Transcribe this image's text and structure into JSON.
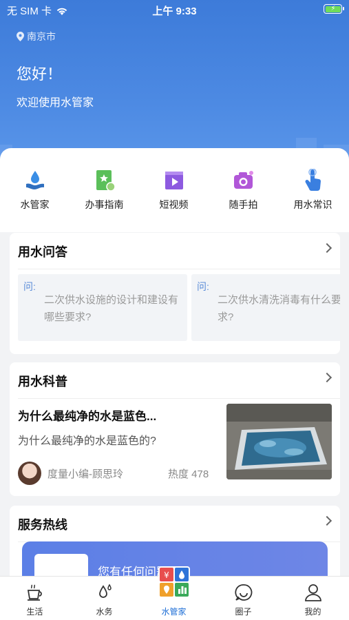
{
  "status_bar": {
    "carrier": "无 SIM 卡",
    "time": "上午 9:33"
  },
  "header": {
    "location": "南京市",
    "greeting": "您好！",
    "welcome": "欢迎使用水管家"
  },
  "menu": [
    {
      "label": "水管家",
      "icon": "water-hand-icon"
    },
    {
      "label": "办事指南",
      "icon": "guide-book-icon"
    },
    {
      "label": "短视频",
      "icon": "video-icon"
    },
    {
      "label": "随手拍",
      "icon": "camera-icon"
    },
    {
      "label": "用水常识",
      "icon": "tap-hand-icon"
    }
  ],
  "qa": {
    "title": "用水问答",
    "items": [
      {
        "prefix": "问:",
        "text": "二次供水设施的设计和建设有哪些要求?"
      },
      {
        "prefix": "问:",
        "text": "二次供水清洗消毒有什么要求?"
      }
    ]
  },
  "science": {
    "title": "用水科普",
    "article": {
      "headline": "为什么最纯净的水是蓝色...",
      "subtitle": "为什么最纯净的水是蓝色的?",
      "author": "度量小编-顾思玲",
      "heat": "热度 478"
    }
  },
  "hotline": {
    "title": "服务热线",
    "banner_text": "您有任何问题"
  },
  "tabbar": [
    {
      "label": "生活",
      "icon": "coffee-cup-icon"
    },
    {
      "label": "水务",
      "icon": "water-drops-icon"
    },
    {
      "label": "水管家",
      "icon": "app-grid-icon",
      "active": true
    },
    {
      "label": "圈子",
      "icon": "chat-bubble-icon"
    },
    {
      "label": "我的",
      "icon": "user-icon"
    }
  ],
  "colors": {
    "primary": "#4d8ae3",
    "accent_blue": "#1f6fd6",
    "question_blue": "#5a8bd8"
  }
}
